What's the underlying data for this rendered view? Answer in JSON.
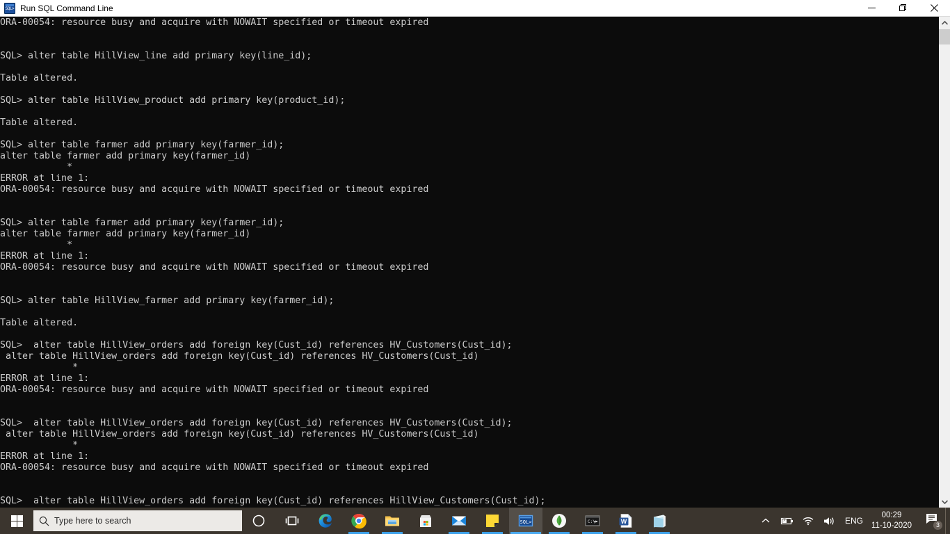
{
  "window": {
    "title": "Run SQL Command Line",
    "icon": "sql-app-icon",
    "icon_text": "SQL>",
    "controls": [
      {
        "name": "minimize-button",
        "label": "Minimize"
      },
      {
        "name": "restore-button",
        "label": "Restore"
      },
      {
        "name": "close-button",
        "label": "Close"
      }
    ]
  },
  "console": {
    "background": "#0c0c0c",
    "foreground": "#cccccc",
    "lines": [
      "ORA-00054: resource busy and acquire with NOWAIT specified or timeout expired",
      "",
      "",
      "SQL> alter table HillView_line add primary key(line_id);",
      "",
      "Table altered.",
      "",
      "SQL> alter table HillView_product add primary key(product_id);",
      "",
      "Table altered.",
      "",
      "SQL> alter table farmer add primary key(farmer_id);",
      "alter table farmer add primary key(farmer_id)",
      "            *",
      "ERROR at line 1:",
      "ORA-00054: resource busy and acquire with NOWAIT specified or timeout expired",
      "",
      "",
      "SQL> alter table farmer add primary key(farmer_id);",
      "alter table farmer add primary key(farmer_id)",
      "            *",
      "ERROR at line 1:",
      "ORA-00054: resource busy and acquire with NOWAIT specified or timeout expired",
      "",
      "",
      "SQL> alter table HillView_farmer add primary key(farmer_id);",
      "",
      "Table altered.",
      "",
      "SQL>  alter table HillView_orders add foreign key(Cust_id) references HV_Customers(Cust_id);",
      " alter table HillView_orders add foreign key(Cust_id) references HV_Customers(Cust_id)",
      "             *",
      "ERROR at line 1:",
      "ORA-00054: resource busy and acquire with NOWAIT specified or timeout expired",
      "",
      "",
      "SQL>  alter table HillView_orders add foreign key(Cust_id) references HV_Customers(Cust_id);",
      " alter table HillView_orders add foreign key(Cust_id) references HV_Customers(Cust_id)",
      "             *",
      "ERROR at line 1:",
      "ORA-00054: resource busy and acquire with NOWAIT specified or timeout expired",
      "",
      "",
      "SQL>  alter table HillView_orders add foreign key(Cust_id) references HillView_Customers(Cust_id);"
    ]
  },
  "scrollbar": {
    "up_arrow": "chevron-up-icon",
    "down_arrow": "chevron-down-icon",
    "thumb": "scrollbar-thumb"
  },
  "taskbar": {
    "background": "#3b352e",
    "start": {
      "name": "start-button",
      "label": "Start"
    },
    "search": {
      "placeholder": "Type here to search",
      "icon": "search-icon"
    },
    "items": [
      {
        "name": "cortana-icon",
        "label": "Cortana",
        "running": false,
        "active": false
      },
      {
        "name": "task-view-icon",
        "label": "Task View",
        "running": false,
        "active": false
      },
      {
        "name": "microsoft-edge-icon",
        "label": "Microsoft Edge",
        "running": false,
        "active": false
      },
      {
        "name": "google-chrome-icon",
        "label": "Google Chrome",
        "running": true,
        "active": false
      },
      {
        "name": "file-explorer-icon",
        "label": "File Explorer",
        "running": true,
        "active": false
      },
      {
        "name": "microsoft-store-icon",
        "label": "Microsoft Store",
        "running": false,
        "active": false
      },
      {
        "name": "mail-icon",
        "label": "Mail",
        "running": true,
        "active": false
      },
      {
        "name": "sticky-notes-icon",
        "label": "Sticky Notes",
        "running": true,
        "active": false
      },
      {
        "name": "sql-command-line-icon",
        "label": "Run SQL Command Line",
        "running": true,
        "active": true
      },
      {
        "name": "mongodb-compass-icon",
        "label": "MongoDB Compass",
        "running": true,
        "active": false
      },
      {
        "name": "command-prompt-icon",
        "label": "Command Prompt",
        "running": true,
        "active": false
      },
      {
        "name": "microsoft-word-icon",
        "label": "Microsoft Word",
        "running": true,
        "active": false
      },
      {
        "name": "notepad-icon",
        "label": "Notepad",
        "running": true,
        "active": false
      }
    ],
    "tray": {
      "overflow": "chevron-up-icon",
      "battery": "battery-charging-icon",
      "network": "wifi-icon",
      "volume": "speaker-icon",
      "language": "ENG",
      "time": "00:29",
      "date": "11-10-2020",
      "notifications": {
        "icon": "action-center-icon",
        "count": "3"
      }
    }
  }
}
